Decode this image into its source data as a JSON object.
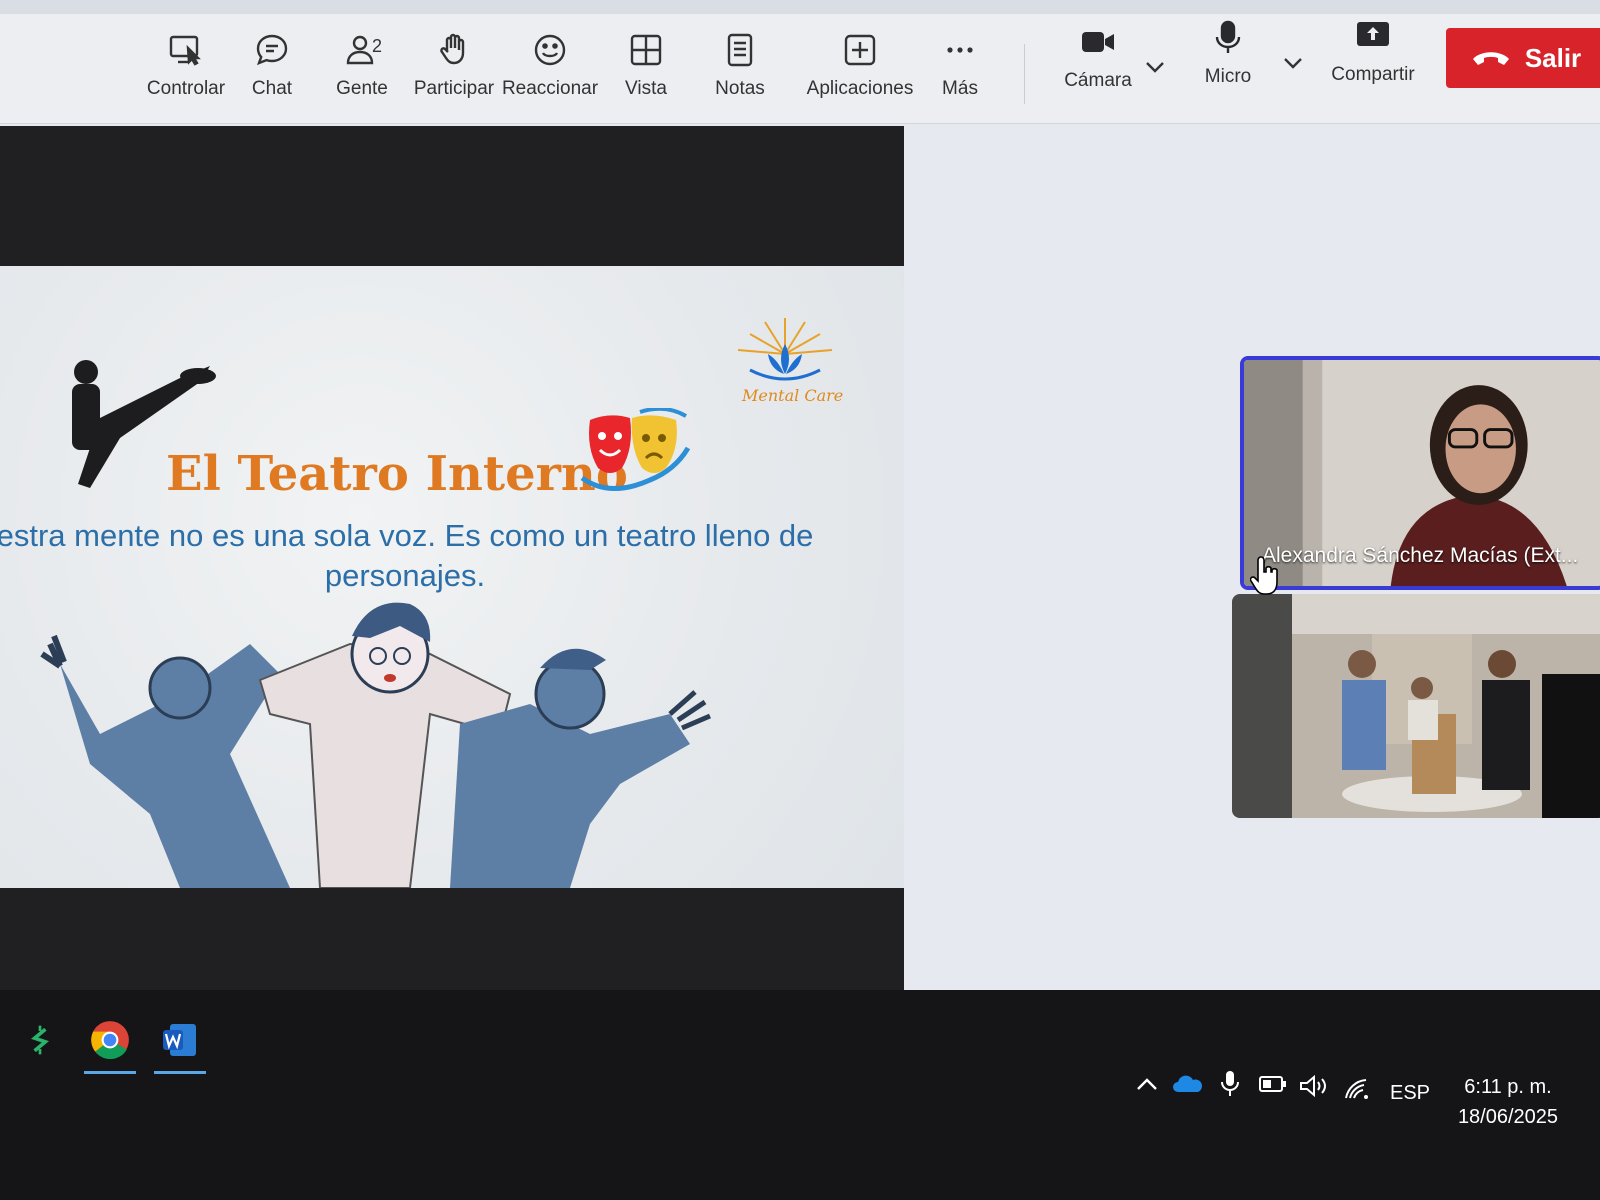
{
  "toolbar": {
    "items": [
      {
        "id": "controlar",
        "label": "Controlar",
        "icon": "remote-control-icon"
      },
      {
        "id": "chat",
        "label": "Chat",
        "icon": "chat-icon"
      },
      {
        "id": "gente",
        "label": "Gente",
        "icon": "people-icon",
        "count": "2"
      },
      {
        "id": "participar",
        "label": "Participar",
        "icon": "raise-hand-icon"
      },
      {
        "id": "reaccionar",
        "label": "Reaccionar",
        "icon": "smiley-icon"
      },
      {
        "id": "vista",
        "label": "Vista",
        "icon": "grid-view-icon"
      },
      {
        "id": "notas",
        "label": "Notas",
        "icon": "notes-icon"
      },
      {
        "id": "aplicaciones",
        "label": "Aplicaciones",
        "icon": "add-app-icon"
      },
      {
        "id": "mas",
        "label": "Más",
        "icon": "more-icon"
      }
    ],
    "media": [
      {
        "id": "camara",
        "label": "Cámara",
        "icon": "video-camera-icon"
      },
      {
        "id": "micro",
        "label": "Micro",
        "icon": "microphone-icon"
      },
      {
        "id": "compartir",
        "label": "Compartir",
        "icon": "share-screen-icon"
      }
    ],
    "leave_label": "Salir",
    "leave_color": "#d8232a"
  },
  "slide": {
    "title": "El Teatro Interno",
    "text": "estra mente no es una sola voz. Es como un teatro lleno de personajes.",
    "logo_text": "Mental Care",
    "title_color": "#e07a22",
    "text_color": "#2c6ea8"
  },
  "participants": [
    {
      "name": "Alexandra Sánchez Macías (Ext...",
      "active": true
    },
    {
      "name": ""
    }
  ],
  "active_speaker_color": "#3a3ad6",
  "taskbar": {
    "apps": [
      "money-app-icon",
      "chrome-icon",
      "word-icon"
    ],
    "tray": [
      "chevron-up-icon",
      "onedrive-icon",
      "microphone-icon",
      "battery-icon",
      "volume-icon",
      "wifi-icon"
    ],
    "language": "ESP",
    "time": "6:11 p. m.",
    "date": "18/06/2025"
  }
}
